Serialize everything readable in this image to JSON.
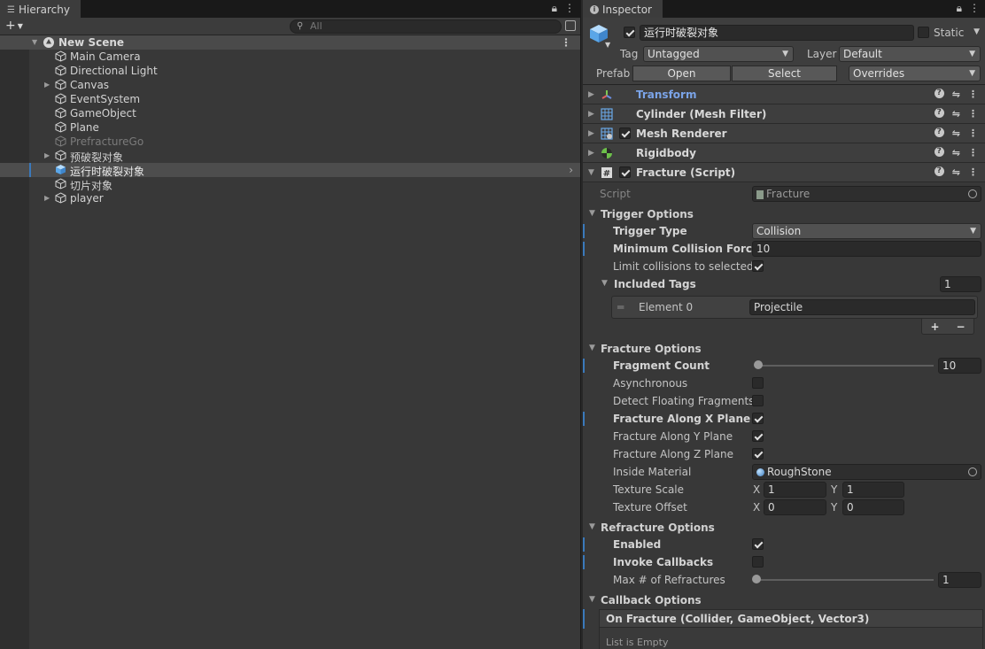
{
  "hierarchy": {
    "tab_label": "Hierarchy",
    "search_placeholder": "All",
    "scene_name": "New Scene",
    "items": [
      {
        "label": "Main Camera"
      },
      {
        "label": "Directional Light"
      },
      {
        "label": "Canvas"
      },
      {
        "label": "EventSystem"
      },
      {
        "label": "GameObject"
      },
      {
        "label": "Plane"
      },
      {
        "label": "PrefractureGo"
      },
      {
        "label": "预破裂对象"
      },
      {
        "label": "运行时破裂对象"
      },
      {
        "label": "切片对象"
      },
      {
        "label": "player"
      }
    ]
  },
  "inspector": {
    "tab_label": "Inspector",
    "object_name": "运行时破裂对象",
    "static_label": "Static",
    "tag_label": "Tag",
    "tag_value": "Untagged",
    "layer_label": "Layer",
    "layer_value": "Default",
    "prefab_label": "Prefab",
    "prefab_open": "Open",
    "prefab_select": "Select",
    "prefab_overrides": "Overrides",
    "components": [
      {
        "name": "Transform"
      },
      {
        "name": "Cylinder (Mesh Filter)"
      },
      {
        "name": "Mesh Renderer"
      },
      {
        "name": "Rigidbody"
      },
      {
        "name": "Fracture (Script)"
      }
    ],
    "script_label": "Script",
    "script_value": "Fracture",
    "trigger_options": {
      "title": "Trigger Options",
      "trigger_type_label": "Trigger Type",
      "trigger_type_value": "Collision",
      "min_force_label": "Minimum Collision Force",
      "min_force_value": "10",
      "limit_label": "Limit collisions to selected t",
      "limit_checked": true,
      "included_tags_label": "Included Tags",
      "included_tags_count": "1",
      "element0_label": "Element 0",
      "element0_value": "Projectile",
      "plus": "+",
      "minus": "−"
    },
    "fracture_options": {
      "title": "Fracture Options",
      "fragment_count_label": "Fragment Count",
      "fragment_count_value": "10",
      "async_label": "Asynchronous",
      "async_checked": false,
      "detect_label": "Detect Floating Fragments",
      "detect_checked": false,
      "x_plane_label": "Fracture Along X Plane",
      "x_plane_checked": true,
      "y_plane_label": "Fracture Along Y Plane",
      "y_plane_checked": true,
      "z_plane_label": "Fracture Along Z Plane",
      "z_plane_checked": true,
      "inside_material_label": "Inside Material",
      "inside_material_value": "RoughStone",
      "texture_scale_label": "Texture Scale",
      "texture_scale_x": "1",
      "texture_scale_y": "1",
      "texture_offset_label": "Texture Offset",
      "texture_offset_x": "0",
      "texture_offset_y": "0",
      "x_axis": "X",
      "y_axis": "Y"
    },
    "refracture_options": {
      "title": "Refracture Options",
      "enabled_label": "Enabled",
      "enabled_checked": true,
      "invoke_label": "Invoke Callbacks",
      "invoke_checked": false,
      "max_label": "Max # of Refractures",
      "max_value": "1"
    },
    "callback_options": {
      "title": "Callback Options",
      "event_header": "On Fracture (Collider, GameObject, Vector3)",
      "event_list_text": "List is Empty"
    }
  },
  "colors": {
    "accent": "#3a79bb",
    "panel": "#383838",
    "transform_label": "#7ba4e8"
  }
}
